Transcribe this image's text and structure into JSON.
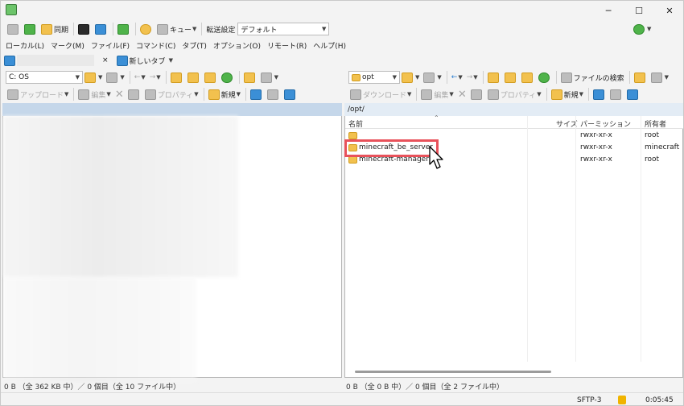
{
  "toolbar1": {
    "sync_label": "同期",
    "queue_label": "キュー",
    "transfer_setting_label": "転送設定",
    "transfer_setting_value": "デフォルト"
  },
  "menu": [
    "ローカル(L)",
    "マーク(M)",
    "ファイル(F)",
    "コマンド(C)",
    "タブ(T)",
    "オプション(O)",
    "リモート(R)",
    "ヘルプ(H)"
  ],
  "tabs": {
    "close_glyph": "×",
    "new_tab_label": "新しいタブ"
  },
  "left": {
    "drive": "C: OS",
    "upload_label": "アップロード",
    "edit_label": "編集",
    "properties_label": "プロパティ",
    "new_label": "新規",
    "status": "0 B （全 362 KB 中）／ 0 個目（全 10 ファイル中）"
  },
  "right": {
    "dir": "opt",
    "find_files_label": "ファイルの検索",
    "download_label": "ダウンロード",
    "edit_label": "編集",
    "properties_label": "プロパティ",
    "new_label": "新規",
    "path": "/opt/",
    "columns": {
      "name": "名前",
      "size": "サイズ",
      "perm": "パーミッション",
      "owner": "所有者"
    },
    "files": [
      {
        "name": "..",
        "perm": "rwxr-xr-x",
        "owner": "root"
      },
      {
        "name": "minecraft_be_server",
        "perm": "rwxr-xr-x",
        "owner": "minecraft"
      },
      {
        "name": "minecraft-manager",
        "perm": "rwxr-xr-x",
        "owner": "root"
      }
    ],
    "status": "0 B （全 0 B 中）／ 0 個目（全 2 ファイル中）"
  },
  "statusbar": {
    "protocol": "SFTP-3",
    "elapsed": "0:05:45"
  },
  "colors": {
    "highlight": "#e8525b",
    "pane_header": "#c5d7ea",
    "folder": "#f2c14e"
  }
}
